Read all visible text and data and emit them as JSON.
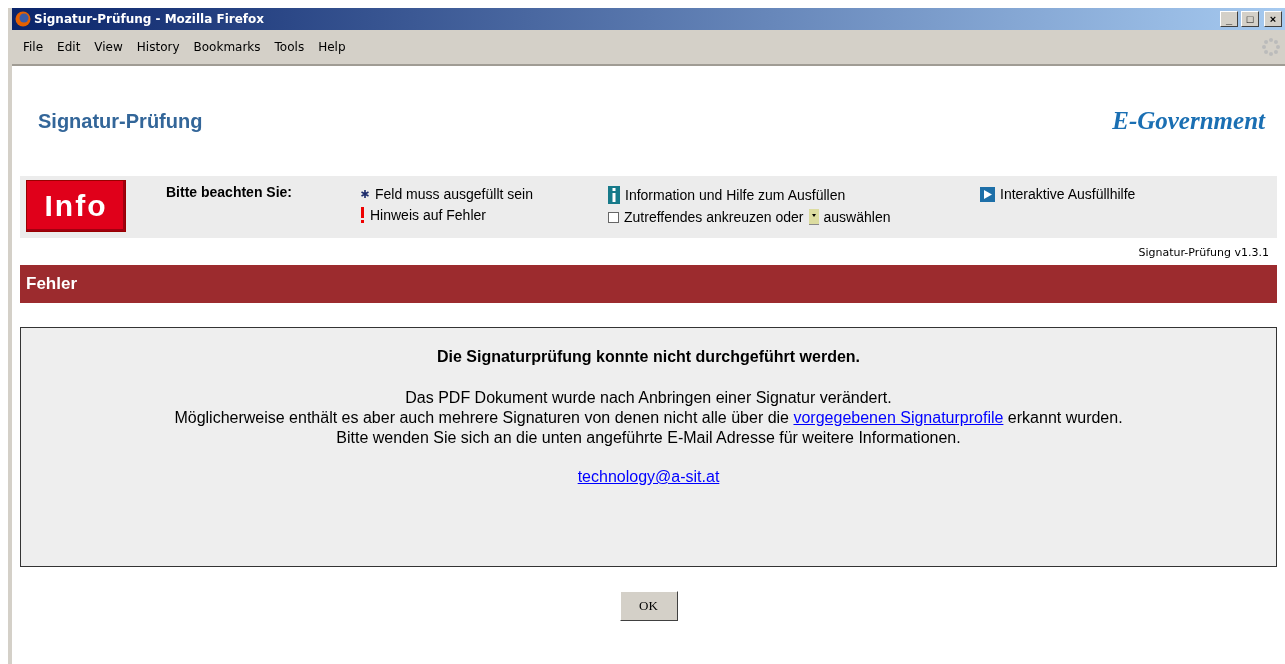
{
  "window": {
    "title": "Signatur-Prüfung - Mozilla Firefox",
    "controls": [
      "_",
      "□",
      "×"
    ]
  },
  "menu": [
    "File",
    "Edit",
    "View",
    "History",
    "Bookmarks",
    "Tools",
    "Help"
  ],
  "header": {
    "title": "Signatur-Prüfung",
    "logo": "E-Government"
  },
  "info": {
    "badge": "Info",
    "heading": "Bitte beachten Sie:",
    "legend": [
      {
        "kind": "asterisk",
        "text": "Feld muss ausgefüllt sein"
      },
      {
        "kind": "exclamation",
        "text": "Hinweis auf Fehler"
      },
      {
        "kind": "info",
        "text": "Information und Hilfe zum Ausfüllen"
      },
      {
        "kind": "checkbox",
        "text": "Zutreffendes ankreuzen oder",
        "text_after": "auswählen"
      },
      {
        "kind": "play",
        "text": "Interaktive Ausfüllhilfe"
      }
    ]
  },
  "version": "Signatur-Prüfung v1.3.1",
  "section": {
    "title": "Fehler"
  },
  "message": {
    "heading": "Die Signaturprüfung konnte nicht durchgeführt werden.",
    "line_1": "Das PDF Dokument wurde nach Anbringen einer Signatur verändert.",
    "line_2_before": "Möglicherweise enthält es aber auch mehrere Signaturen von denen nicht alle über die",
    "line_2_link": "vorgegebenen Signaturprofile",
    "line_2_after": "erkannt wurden.",
    "line_3": "Bitte wenden Sie sich an die unten angeführte E-Mail Adresse für weitere Informationen.",
    "email": "technology@a-sit.at"
  },
  "buttons": [
    "OK"
  ]
}
